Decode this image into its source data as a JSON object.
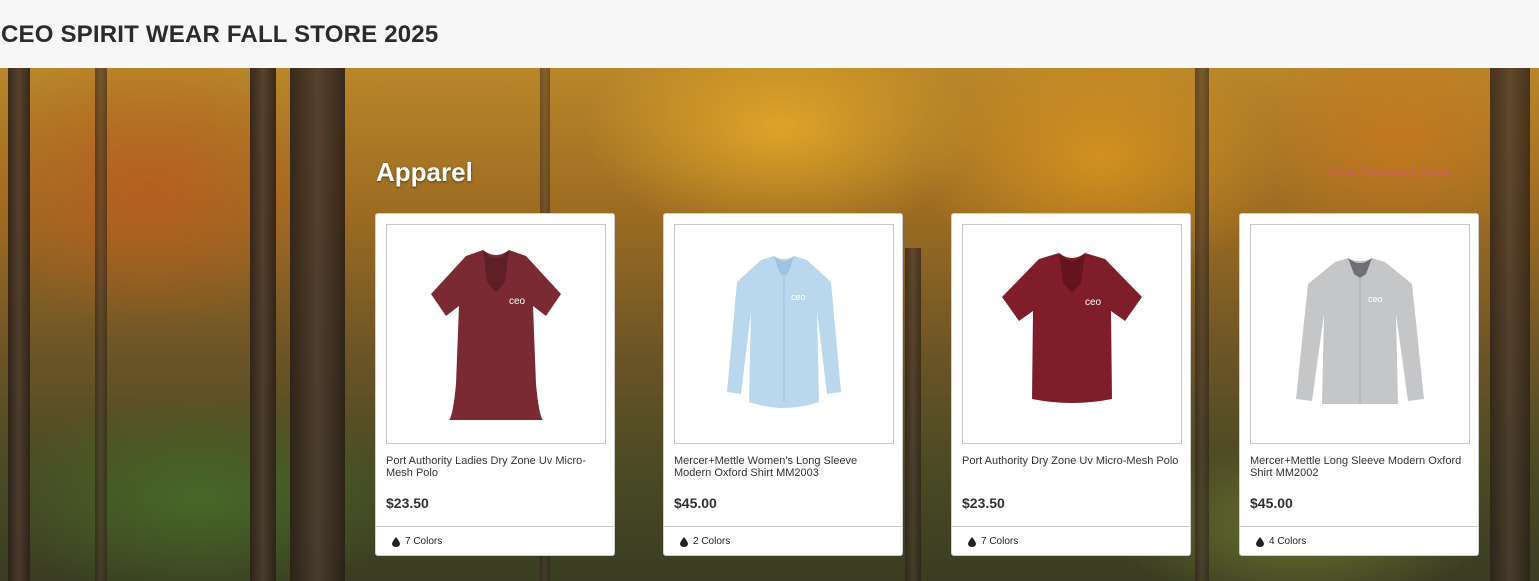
{
  "header": {
    "title": "CEO SPIRIT WEAR FALL STORE 2025"
  },
  "section": {
    "title": "Apparel",
    "link_label": "View Category Page"
  },
  "products": [
    {
      "name": "Port Authority Ladies Dry Zone Uv Micro-Mesh Polo",
      "price": "$23.50",
      "colors": "7 Colors",
      "shirt_color": "#7a2a33",
      "shirt_type": "polo-ladies"
    },
    {
      "name": "Mercer+Mettle Women's Long Sleeve Modern Oxford Shirt MM2003",
      "price": "$45.00",
      "colors": "2 Colors",
      "shirt_color": "#b9d8ee",
      "shirt_type": "oxford"
    },
    {
      "name": "Port Authority Dry Zone Uv Micro-Mesh Polo",
      "price": "$23.50",
      "colors": "7 Colors",
      "shirt_color": "#7f1d2b",
      "shirt_type": "polo"
    },
    {
      "name": "Mercer+Mettle Long Sleeve Modern Oxford Shirt MM2002",
      "price": "$45.00",
      "colors": "4 Colors",
      "shirt_color": "#c5c6c8",
      "shirt_type": "oxford"
    }
  ],
  "colors": {
    "link": "#c9644f",
    "title_text": "#2b2b2b"
  }
}
